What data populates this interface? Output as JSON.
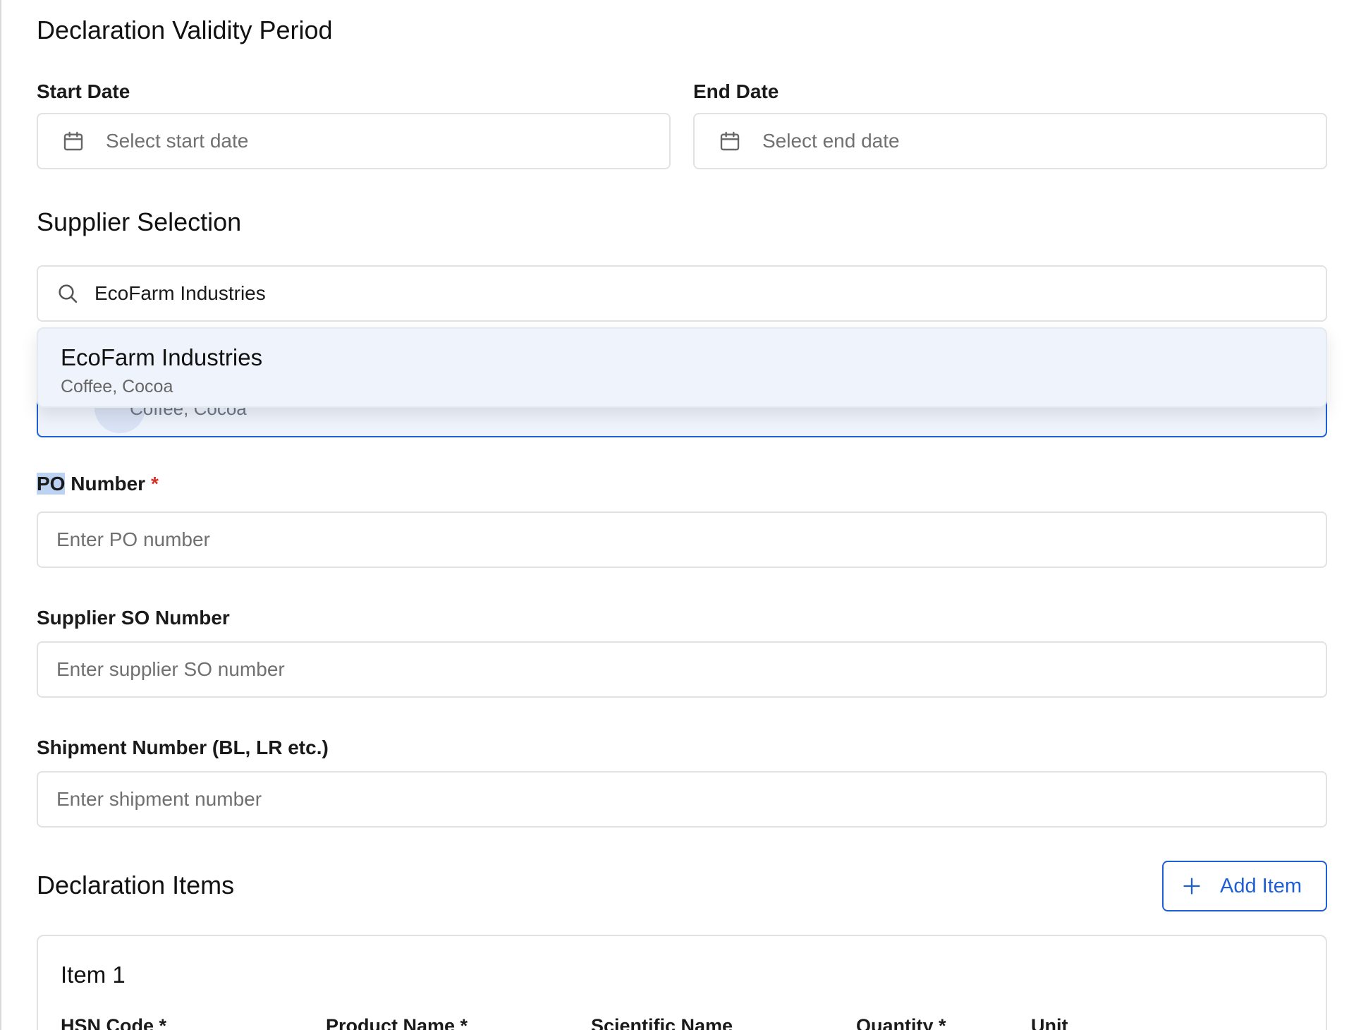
{
  "validity": {
    "title": "Declaration Validity Period",
    "start_label": "Start Date",
    "start_placeholder": "Select start date",
    "end_label": "End Date",
    "end_placeholder": "Select end date"
  },
  "supplier": {
    "title": "Supplier Selection",
    "search_value": "EcoFarm Industries",
    "dropdown_option": {
      "name": "EcoFarm Industries",
      "tags": "Coffee, Cocoa"
    },
    "selected_tags_partial": "Coffee, Cocoa"
  },
  "po": {
    "label_prefix": "PO",
    "label_suffix": " Number",
    "required_mark": "*",
    "placeholder": "Enter PO number"
  },
  "so": {
    "label": "Supplier SO Number",
    "placeholder": "Enter supplier SO number"
  },
  "shipment": {
    "label": "Shipment Number (BL, LR etc.)",
    "placeholder": "Enter shipment number"
  },
  "items": {
    "title": "Declaration Items",
    "add_button": "Add Item",
    "card_title": "Item 1",
    "columns": [
      "HSN Code *",
      "Product Name *",
      "Scientific Name",
      "Quantity *",
      "Unit"
    ]
  },
  "colors": {
    "accent": "#1f5fd6",
    "required": "#d93025",
    "highlight": "#bcd2f3"
  },
  "icons": {
    "date": "calendar-icon",
    "search": "search-icon",
    "add": "plus-icon"
  }
}
